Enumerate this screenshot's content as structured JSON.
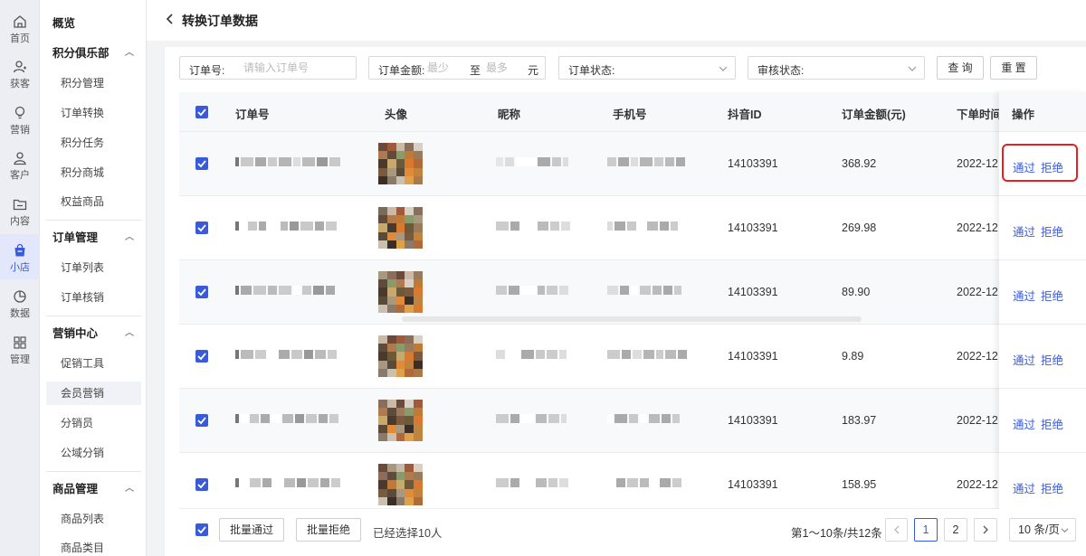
{
  "rail": {
    "items": [
      {
        "label": "首页",
        "icon": "home-icon"
      },
      {
        "label": "获客",
        "icon": "user-plus-icon"
      },
      {
        "label": "营销",
        "icon": "lightbulb-icon"
      },
      {
        "label": "客户",
        "icon": "user-icon"
      },
      {
        "label": "内容",
        "icon": "folder-icon"
      },
      {
        "label": "小店",
        "icon": "shop-bag-icon",
        "active": true
      },
      {
        "label": "数据",
        "icon": "pie-chart-icon"
      },
      {
        "label": "管理",
        "icon": "grid-icon"
      }
    ]
  },
  "menu": {
    "overview": "概览",
    "groups": [
      {
        "title": "积分俱乐部",
        "items": [
          "积分管理",
          "订单转换",
          "积分任务",
          "积分商城",
          "权益商品"
        ]
      },
      {
        "title": "订单管理",
        "items": [
          "订单列表",
          "订单核销"
        ]
      },
      {
        "title": "营销中心",
        "items": [
          "促销工具",
          "会员营销",
          "分销员",
          "公域分销"
        ]
      },
      {
        "title": "商品管理",
        "items": [
          "商品列表",
          "商品类目"
        ]
      }
    ],
    "active_item": "会员营销"
  },
  "header": {
    "title": "转换订单数据"
  },
  "filters": {
    "order_no_label": "订单号:",
    "order_no_placeholder": "请输入订单号",
    "amount_label": "订单金额:",
    "amount_min_placeholder": "最少",
    "amount_to": "至",
    "amount_max_placeholder": "最多",
    "amount_unit": "元",
    "order_status_label": "订单状态:",
    "audit_status_label": "审核状态:",
    "query_button": "查 询",
    "reset_button": "重 置"
  },
  "table": {
    "columns": [
      "订单号",
      "头像",
      "昵称",
      "手机号",
      "抖音ID",
      "订单金额(元)",
      "下单时间",
      "操作"
    ],
    "rows": [
      {
        "douyin_id": "14103391",
        "amount": "368.92",
        "time": "2022-12"
      },
      {
        "douyin_id": "14103391",
        "amount": "269.98",
        "time": "2022-12"
      },
      {
        "douyin_id": "14103391",
        "amount": "89.90",
        "time": "2022-12"
      },
      {
        "douyin_id": "14103391",
        "amount": "9.89",
        "time": "2022-12"
      },
      {
        "douyin_id": "14103391",
        "amount": "183.97",
        "time": "2022-12"
      },
      {
        "douyin_id": "14103391",
        "amount": "158.95",
        "time": "2022-12"
      }
    ],
    "approve_label": "通过",
    "reject_label": "拒绝",
    "highlight_color": "#e02424"
  },
  "footer": {
    "batch_approve": "批量通过",
    "batch_reject": "批量拒绝",
    "selected_text": "已经选择10人",
    "range_text": "第1～10条/共12条",
    "pages": [
      "1",
      "2"
    ],
    "current_page": "1",
    "page_size": "10 条/页"
  },
  "colors": {
    "accent": "#3a5bd9"
  }
}
